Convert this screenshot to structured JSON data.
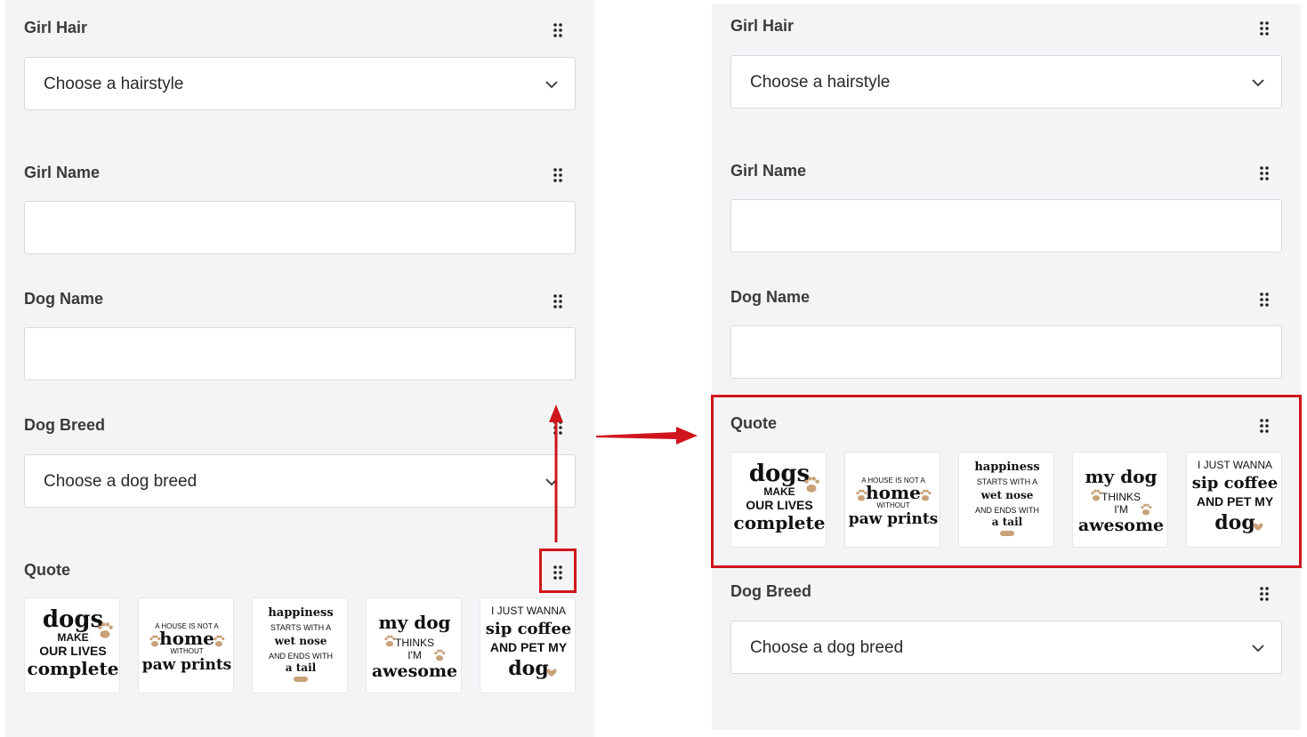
{
  "before": {
    "girl_hair": {
      "label": "Girl Hair",
      "placeholder": "Choose a hairstyle"
    },
    "girl_name": {
      "label": "Girl Name",
      "value": ""
    },
    "dog_name": {
      "label": "Dog Name",
      "value": ""
    },
    "dog_breed": {
      "label": "Dog Breed",
      "placeholder": "Choose a dog breed"
    },
    "quote": {
      "label": "Quote"
    }
  },
  "after": {
    "girl_hair": {
      "label": "Girl Hair",
      "placeholder": "Choose a hairstyle"
    },
    "girl_name": {
      "label": "Girl Name",
      "value": ""
    },
    "dog_name": {
      "label": "Dog Name",
      "value": ""
    },
    "quote": {
      "label": "Quote"
    },
    "dog_breed": {
      "label": "Dog Breed",
      "placeholder": "Choose a dog breed"
    }
  },
  "quote_options": [
    {
      "name": "dogs-make-our-lives-complete",
      "lines": [
        "dogs",
        "MAKE",
        "OUR LIVES",
        "complete"
      ]
    },
    {
      "name": "a-house-is-not-a-home-without-paw-prints",
      "lines": [
        "A HOUSE IS NOT A",
        "home",
        "WITHOUT",
        "paw prints"
      ]
    },
    {
      "name": "happiness-starts-with-a-wet-nose",
      "lines": [
        "happiness",
        "STARTS WITH A",
        "wet nose",
        "AND ENDS WITH",
        "a tail"
      ]
    },
    {
      "name": "my-dog-thinks-im-awesome",
      "lines": [
        "my dog",
        "THINKS",
        "I'M",
        "awesome"
      ]
    },
    {
      "name": "i-just-wanna-sip-coffee-and-pet-my-dog",
      "lines": [
        "I JUST WANNA",
        "sip coffee",
        "AND PET MY",
        "dog"
      ]
    }
  ],
  "colors": {
    "annotation": "#d0151c",
    "panel": "#f4f4f6",
    "paw": "#c9a27a"
  }
}
